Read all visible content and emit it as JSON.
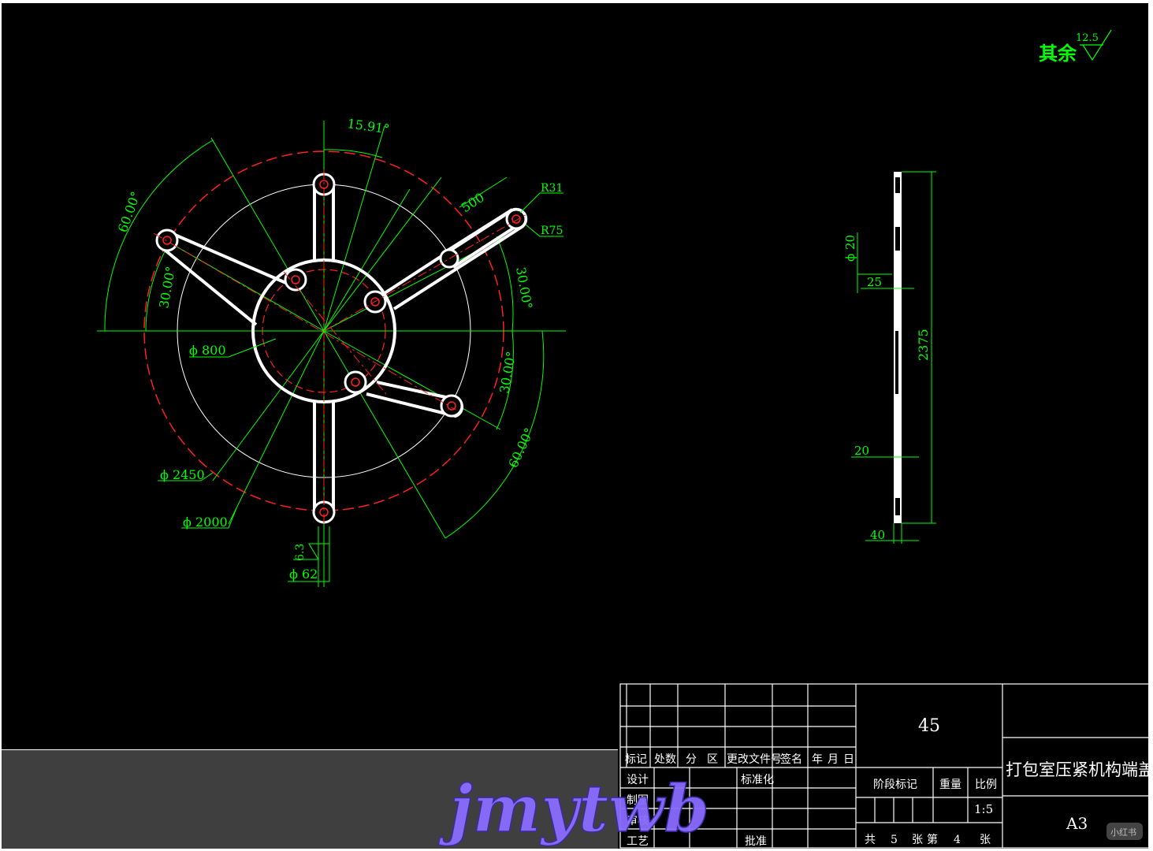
{
  "surface_note": {
    "label": "其余",
    "roughness": "12.5"
  },
  "main_view": {
    "angle_top": "15.91°",
    "angle_left": "60.00°",
    "angle_left_inner": "30.00°",
    "angle_right_upper": "30.00°",
    "angle_right_lower": "30.00°",
    "angle_bottom_right": "60.00°",
    "slot_length": "500",
    "radius_small": "R31",
    "radius_large": "R75",
    "dia_800": "ϕ 800",
    "dia_2450": "ϕ 2450",
    "dia_2000": "ϕ 2000",
    "hole_roughness": "6.3",
    "dia_62": "ϕ 62"
  },
  "side_view": {
    "dia_20": "ϕ 20",
    "dim_25": "25",
    "dim_2375": "2375",
    "dim_20": "20",
    "dim_40": "40"
  },
  "title_block": {
    "material": "45",
    "part_name": "打包室压紧机构端盖",
    "sheet_size": "A3",
    "header_cols": [
      "标记",
      "处数",
      "分",
      "区",
      "更改文件号",
      "签名",
      "年",
      "月",
      "日"
    ],
    "label_design": "设计",
    "label_standard": "标准化",
    "label_drawing": "制图",
    "label_check": "审核",
    "label_process": "工艺",
    "label_approve": "批准",
    "label_stage": "阶段标记",
    "label_weight": "重量",
    "label_scale": "比例",
    "scale_value": "1:5",
    "sheet_total_label": "共",
    "sheet_total": "5",
    "sheet_unit1": "张",
    "sheet_current_label": "第",
    "sheet_current": "4",
    "sheet_unit2": "张"
  },
  "watermark": {
    "text": "jmytwb",
    "badge": "小红书"
  },
  "colors": {
    "background": "#000000",
    "dimension": "#00ff00",
    "centerline": "#ff2020",
    "outline": "#ffffff",
    "watermark": "#8a6cff"
  }
}
